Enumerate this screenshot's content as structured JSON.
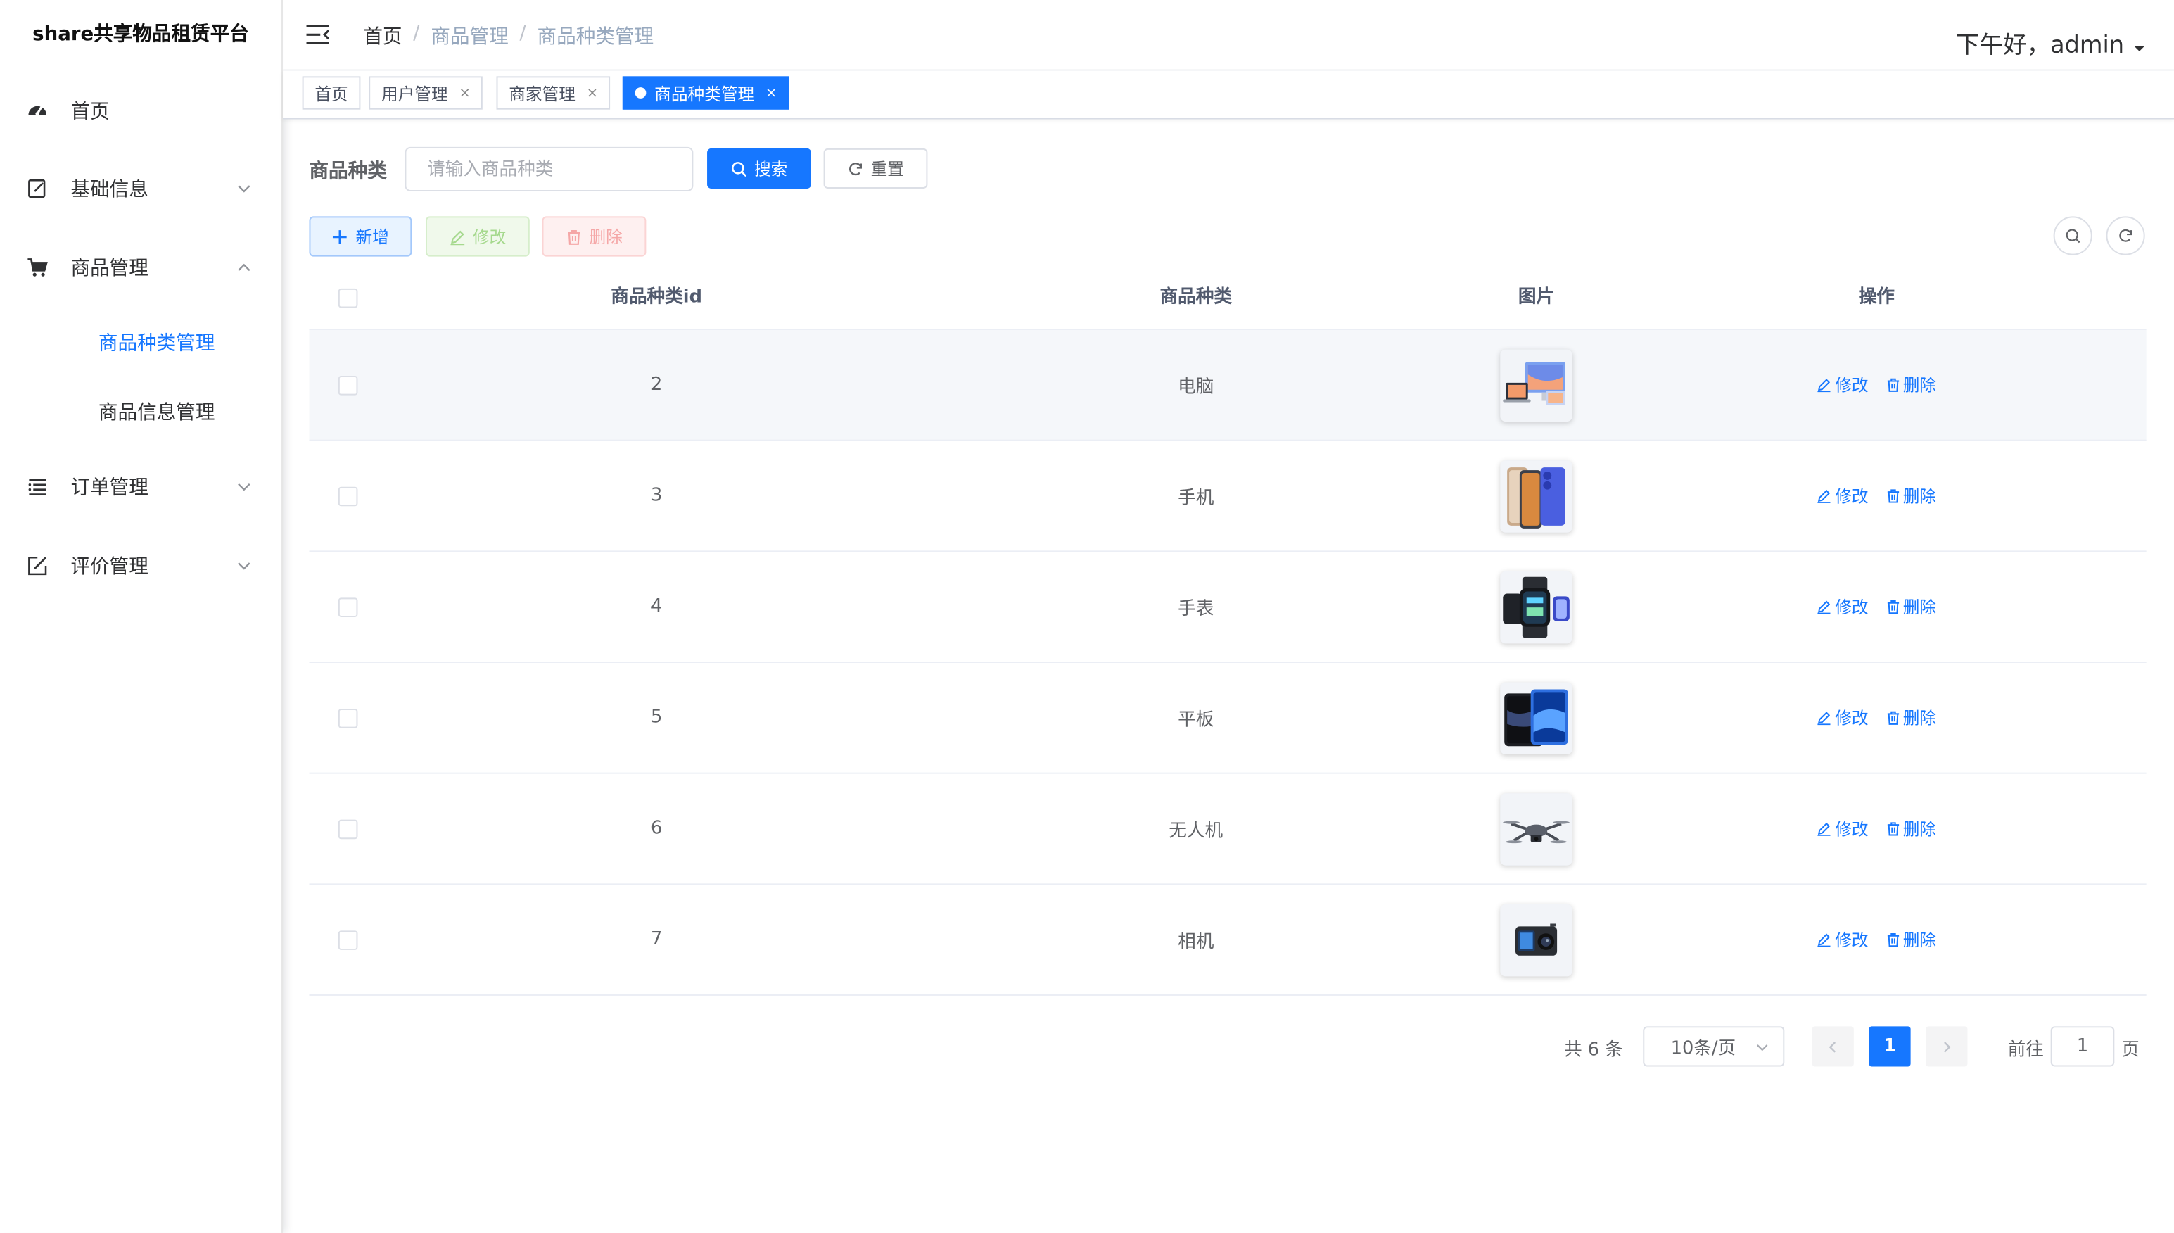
{
  "app": {
    "title": "share共享物品租赁平台"
  },
  "colors": {
    "primary": "#1677ff",
    "sidebar_bg": "#ffffff",
    "text": "#303133"
  },
  "sidebar": {
    "items": [
      {
        "label": "首页",
        "icon": "dashboard-icon"
      },
      {
        "label": "基础信息",
        "icon": "edit-doc-icon",
        "expanded": false
      },
      {
        "label": "商品管理",
        "icon": "cart-icon",
        "expanded": true,
        "children": [
          {
            "label": "商品种类管理",
            "active": true
          },
          {
            "label": "商品信息管理",
            "active": false
          }
        ]
      },
      {
        "label": "订单管理",
        "icon": "list-icon",
        "expanded": false
      },
      {
        "label": "评价管理",
        "icon": "edit-icon",
        "expanded": false
      }
    ]
  },
  "header": {
    "breadcrumb": [
      "首页",
      "商品管理",
      "商品种类管理"
    ],
    "greeting": "下午好，admin"
  },
  "tags": [
    {
      "label": "首页",
      "closable": false,
      "active": false
    },
    {
      "label": "用户管理",
      "closable": true,
      "active": false
    },
    {
      "label": "商家管理",
      "closable": true,
      "active": false
    },
    {
      "label": "商品种类管理",
      "closable": true,
      "active": true
    }
  ],
  "search": {
    "label": "商品种类",
    "placeholder": "请输入商品种类",
    "value": "",
    "search_button": "搜索",
    "reset_button": "重置"
  },
  "toolbar": {
    "add": "新增",
    "edit": "修改",
    "delete": "删除"
  },
  "table": {
    "columns": [
      "商品种类id",
      "商品种类",
      "图片",
      "操作"
    ],
    "rows": [
      {
        "id": "2",
        "name": "电脑",
        "image": "computer"
      },
      {
        "id": "3",
        "name": "手机",
        "image": "phone"
      },
      {
        "id": "4",
        "name": "手表",
        "image": "watch"
      },
      {
        "id": "5",
        "name": "平板",
        "image": "tablet"
      },
      {
        "id": "6",
        "name": "无人机",
        "image": "drone"
      },
      {
        "id": "7",
        "name": "相机",
        "image": "camera"
      }
    ],
    "row_actions": {
      "edit": "修改",
      "delete": "删除"
    }
  },
  "pagination": {
    "total_text": "共 6 条",
    "page_size": "10条/页",
    "current_page": "1",
    "goto_label": "前往",
    "goto_value": "1",
    "page_unit": "页"
  }
}
